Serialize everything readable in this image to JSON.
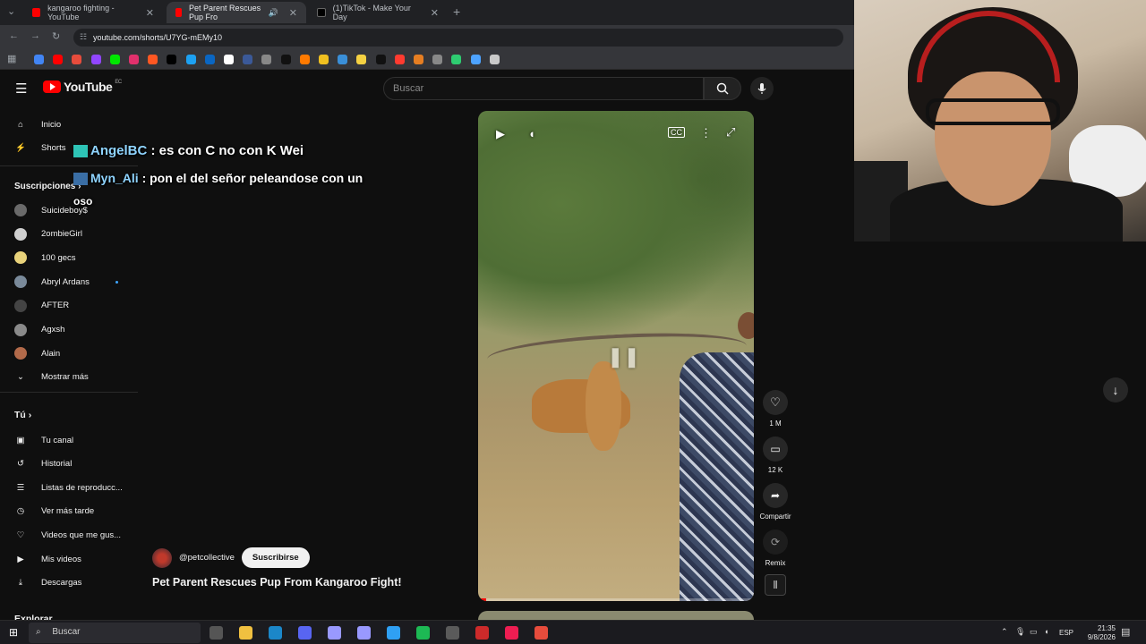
{
  "browser": {
    "tabs": [
      {
        "label": "kangaroo fighting - YouTube",
        "favicon_color": "#ff0000"
      },
      {
        "label": "Pet Parent Rescues Pup Fro",
        "favicon_color": "#ff0000"
      },
      {
        "label": "(1)TikTok - Make Your Day",
        "favicon_color": "#000000"
      }
    ],
    "url": "youtube.com/shorts/U7YG-mEMy10",
    "bookmark_colors": [
      "#4285f4",
      "#ff0000",
      "#e74c3c",
      "#9146ff",
      "#00e600",
      "#e1306c",
      "#ff5722",
      "#000000",
      "#1da1f2",
      "#0a66c2",
      "#ffffff",
      "#3b5998",
      "#888888",
      "#111111",
      "#ff7a00",
      "#f0c020",
      "#3a8fd8",
      "#f5d142",
      "#111111",
      "#ff3b30",
      "#e67e22",
      "#888888",
      "#2ecc71",
      "#4da3ff",
      "#c9c9c9"
    ]
  },
  "youtube": {
    "logo_text": "YouTube",
    "logo_region": "EC",
    "search_placeholder": "Buscar",
    "sidebar": {
      "inicio": "Inicio",
      "shorts": "Shorts",
      "subscriptions_title": "Suscripciones",
      "subscriptions": [
        {
          "name": "Suicideboy$",
          "color": "#6a6a6a"
        },
        {
          "name": "2ombieGirl",
          "color": "#cfcfcf"
        },
        {
          "name": "100 gecs",
          "color": "#e8d27a"
        },
        {
          "name": "Abryl Ardans",
          "color": "#7a8a9a"
        },
        {
          "name": "AFTER",
          "color": "#444444"
        },
        {
          "name": "Agxsh",
          "color": "#8a8a8a"
        },
        {
          "name": "Alain",
          "color": "#b26a4a"
        }
      ],
      "show_more": "Mostrar más",
      "you_title": "Tú",
      "you_items": [
        "Tu canal",
        "Historial",
        "Listas de reproducc...",
        "Ver más tarde",
        "Videos que me gus...",
        "Mis videos",
        "Descargas"
      ],
      "explore_title": "Explorar"
    },
    "short": {
      "channel": "@petcollective",
      "subscribe_label": "Suscribirse",
      "title": "Pet Parent Rescues Pup From Kangaroo Fight!",
      "likes": "1 M",
      "comments": "12 K",
      "share_label": "Compartir",
      "remix_label": "Remix",
      "progress": 0.03
    }
  },
  "chat_overlay": [
    {
      "user": "AngelBC",
      "message": ": es con C no con K Wei"
    },
    {
      "user": "Myn_Ali",
      "message": ": pon el del señor peleandose con un"
    },
    {
      "user": "",
      "message": "oso"
    }
  ],
  "taskbar": {
    "search_placeholder": "Buscar",
    "language": "ESP",
    "time": "21:35",
    "date": "9/8/2026",
    "app_colors": [
      "#555555",
      "#f0c040",
      "#1b87c9",
      "#5865f2",
      "#9999ff",
      "#9999ff",
      "#2fa0f4",
      "#1db954",
      "#5a5a5a",
      "#cc2a2a",
      "#ee1d52",
      "#e74c3c"
    ]
  }
}
